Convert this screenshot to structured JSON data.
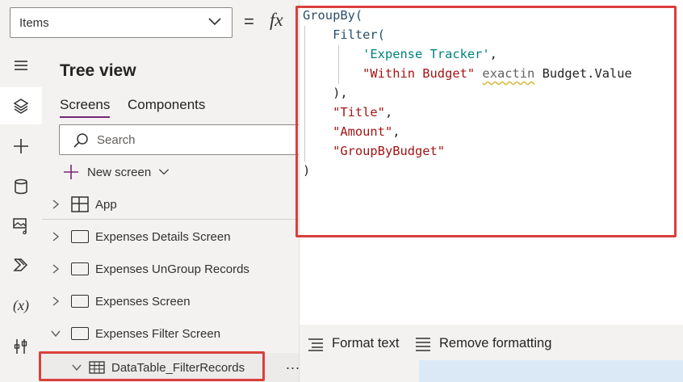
{
  "formula_bar": {
    "property": "Items",
    "equals": "=",
    "fx": "fx"
  },
  "rail": {
    "icons": [
      "hamburger-menu-icon",
      "tree-view-layers-icon",
      "insert-plus-icon",
      "data-cylinder-icon",
      "media-icon",
      "power-automate-icon",
      "variables-icon",
      "tools-icon"
    ],
    "variables_label": "(x)"
  },
  "tree": {
    "title": "Tree view",
    "tabs": [
      {
        "label": "Screens",
        "active": true
      },
      {
        "label": "Components",
        "active": false
      }
    ],
    "search_placeholder": "Search",
    "new_screen_label": "New screen",
    "items": [
      {
        "label": "App",
        "type": "app"
      },
      {
        "label": "Expenses Details Screen",
        "type": "screen",
        "expanded": false
      },
      {
        "label": "Expenses UnGroup Records",
        "type": "screen",
        "expanded": false
      },
      {
        "label": "Expenses Screen",
        "type": "screen",
        "expanded": false
      },
      {
        "label": "Expenses Filter Screen",
        "type": "screen",
        "expanded": true
      }
    ],
    "child": {
      "label": "DataTable_FilterRecords",
      "type": "datatable"
    },
    "more": "..."
  },
  "code": {
    "l1_fn": "GroupBy(",
    "l2_fn": "Filter(",
    "l3_src": "'Expense Tracker'",
    "l3_comma": ",",
    "l4_str": "\"Within Budget\"",
    "l4_op": "exactin",
    "l4_ref": "Budget.Value",
    "l5": "),",
    "l6_str": "\"Title\"",
    "l6_comma": ",",
    "l7_str": "\"Amount\"",
    "l7_comma": ",",
    "l8_str": "\"GroupByBudget\"",
    "l9": ")"
  },
  "format_bar": {
    "format_text": "Format text",
    "remove_formatting": "Remove formatting"
  },
  "colors": {
    "highlight": "#d9403c",
    "accent": "#742774",
    "string": "#a31515",
    "source": "#00827f",
    "function": "#2b4f6a"
  }
}
